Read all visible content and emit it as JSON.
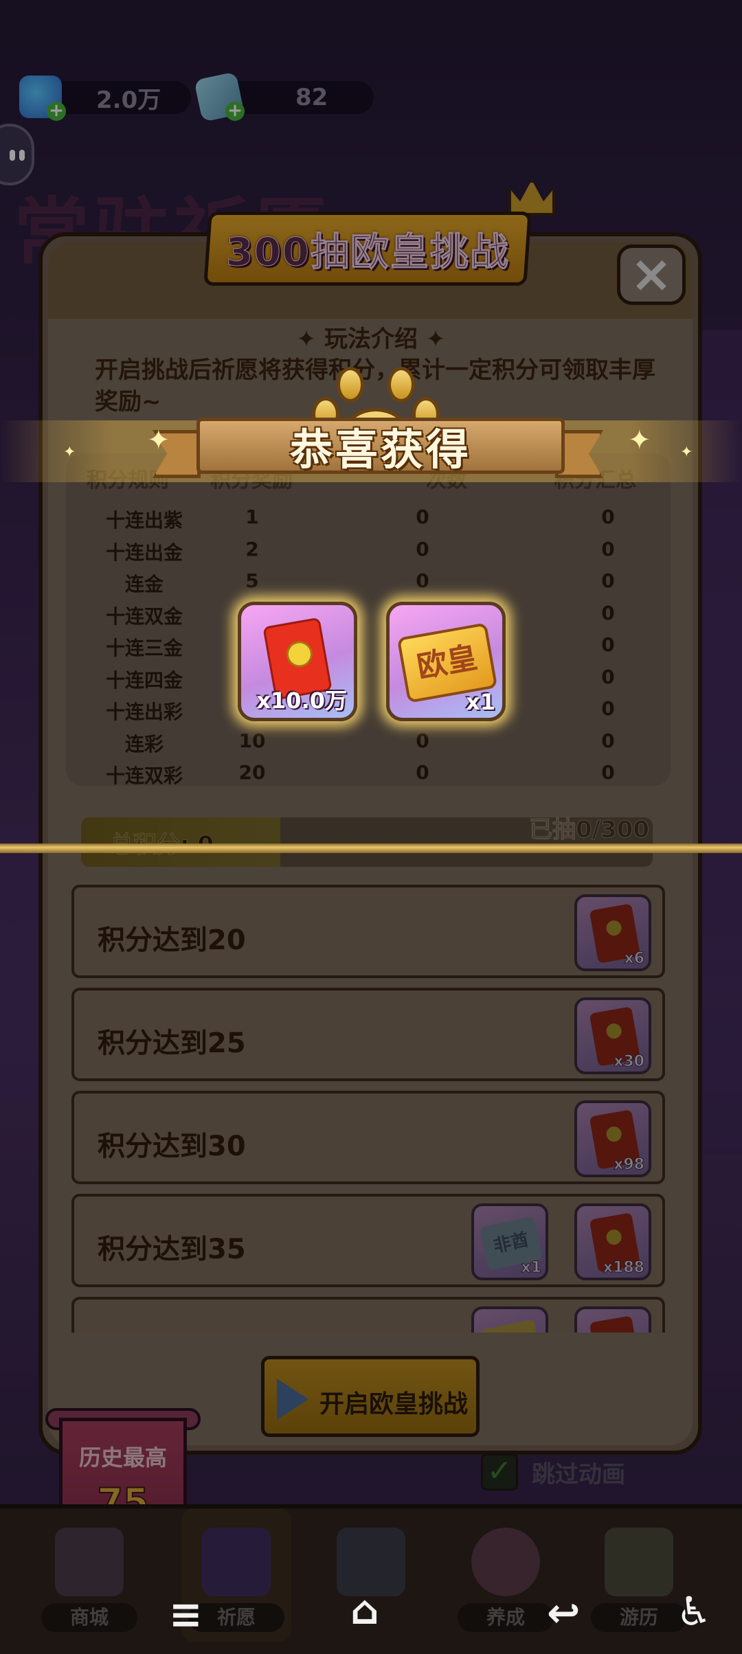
{
  "topbar": {
    "gems": "2.0万",
    "tickets": "82"
  },
  "background": {
    "title": "常驻祈愿"
  },
  "modal": {
    "title": "300抽欧皇挑战",
    "close": "×",
    "rules_title": "✦ 玩法介绍 ✦",
    "rules_text": "开启挑战后祈愿将获得积分，累计一定积分可领取丰厚奖励~",
    "table": {
      "headers": [
        "积分规则",
        "积分奖励",
        "次数",
        "积分汇总"
      ],
      "rows": [
        [
          "十连出紫",
          "1",
          "0",
          "0"
        ],
        [
          "十连出金",
          "2",
          "0",
          "0"
        ],
        [
          "连金",
          "5",
          "0",
          "0"
        ],
        [
          "十连双金",
          "",
          "",
          "0"
        ],
        [
          "十连三金",
          "",
          "",
          "0"
        ],
        [
          "十连四金",
          "",
          "",
          "0"
        ],
        [
          "十连出彩",
          "",
          "",
          "0"
        ],
        [
          "连彩",
          "10",
          "0",
          "0"
        ],
        [
          "十连双彩",
          "20",
          "0",
          "0"
        ]
      ]
    },
    "drawn": "已抽0/300",
    "total_score": "总积分: 0",
    "score_progress": 0,
    "rewards": [
      {
        "label": "积分达到20",
        "items": [
          {
            "icon": "red-envelope-icon",
            "qty": "x6"
          }
        ]
      },
      {
        "label": "积分达到25",
        "items": [
          {
            "icon": "red-envelope-icon",
            "qty": "x30"
          }
        ]
      },
      {
        "label": "积分达到30",
        "items": [
          {
            "icon": "red-envelope-icon",
            "qty": "x98"
          }
        ]
      },
      {
        "label": "积分达到35",
        "items": [
          {
            "icon": "ticket-icon",
            "text": "非酋",
            "qty": "x1"
          },
          {
            "icon": "red-envelope-icon",
            "qty": "x188"
          }
        ]
      },
      {
        "label": "",
        "items": [
          {
            "icon": "ticket-icon",
            "text": ""
          },
          {
            "icon": "red-envelope-icon"
          }
        ]
      }
    ],
    "start_button": "开启欧皇挑战"
  },
  "skip_animation": {
    "label": "跳过动画",
    "checked": true
  },
  "history_best": {
    "label": "历史最高",
    "value": "75"
  },
  "bottom_nav": [
    {
      "label": "商城"
    },
    {
      "label": "祈愿",
      "active": true
    },
    {
      "label": ""
    },
    {
      "label": "养成"
    },
    {
      "label": "游历"
    }
  ],
  "popup": {
    "title": "恭喜获得",
    "prizes": [
      {
        "icon": "red-envelope-icon",
        "qty": "x10.0万"
      },
      {
        "icon": "golden-ticket-icon",
        "text": "欧皇",
        "qty": "x1"
      }
    ]
  },
  "system_nav": {
    "menu": "≡",
    "home": "⌂",
    "back": "↩",
    "accessibility": "♿"
  }
}
